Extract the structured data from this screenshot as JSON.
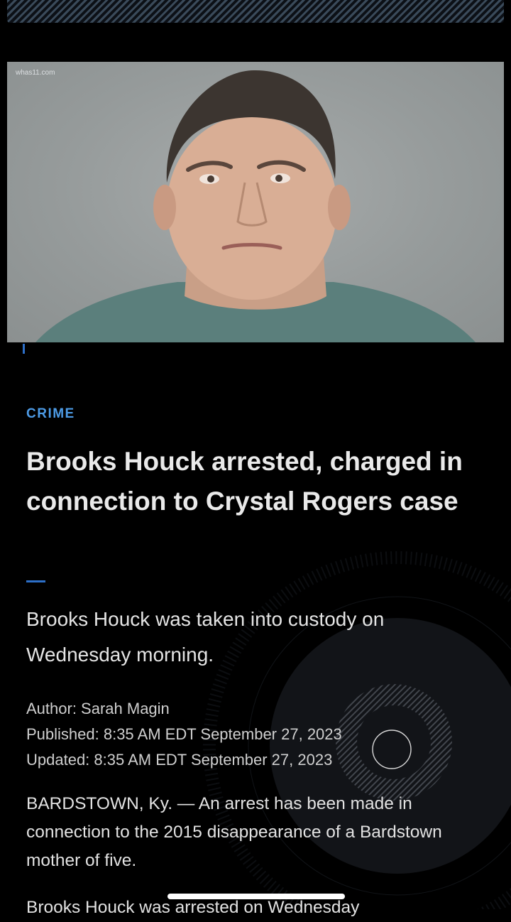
{
  "photo": {
    "watermark": "whas11.com"
  },
  "article": {
    "category": "CRIME",
    "headline": "Brooks Houck arrested, charged in connection to Crystal Rogers case",
    "subhead": "Brooks Houck was taken into custody on Wednesday morning.",
    "author": "Author: Sarah Magin",
    "published": "Published: 8:35 AM EDT September 27, 2023",
    "updated": "Updated: 8:35 AM EDT September 27, 2023",
    "paragraph1": "BARDSTOWN, Ky. — An arrest has been made in connection to the 2015 disappearance of a Bardstown mother of five.",
    "paragraph2": "Brooks Houck was arrested on Wednesday"
  },
  "colors": {
    "accent": "#2d6fc8",
    "category": "#4d9be6",
    "background": "#000000"
  }
}
